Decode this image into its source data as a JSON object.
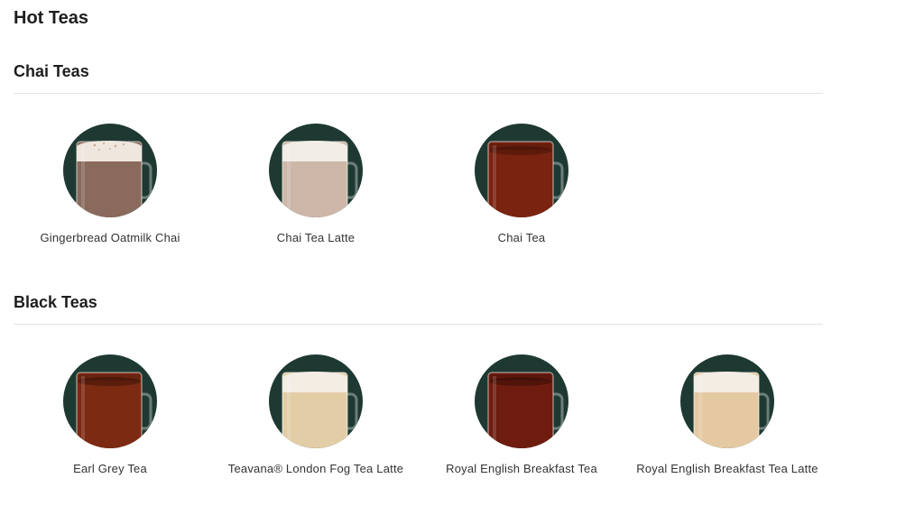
{
  "page": {
    "title": "Hot Teas"
  },
  "sections": [
    {
      "heading": "Chai Teas",
      "products": [
        {
          "name": "Gingerbread Oatmilk Chai",
          "drink": "foam-spiced",
          "body_color": "#8a6a5c",
          "top_color": "#efe6dd"
        },
        {
          "name": "Chai Tea Latte",
          "drink": "latte",
          "body_color": "#cdb7a8",
          "top_color": "#f2ede7"
        },
        {
          "name": "Chai Tea",
          "drink": "tea",
          "body_color": "#7a2310",
          "top_color": "#5e1a0b"
        }
      ]
    },
    {
      "heading": "Black Teas",
      "products": [
        {
          "name": "Earl Grey Tea",
          "drink": "tea",
          "body_color": "#7d2a12",
          "top_color": "#5a1d0c"
        },
        {
          "name": "Teavana® London Fog Tea Latte",
          "drink": "latte",
          "body_color": "#e2cda6",
          "top_color": "#f3ede4"
        },
        {
          "name": "Royal English Breakfast Tea",
          "drink": "tea",
          "body_color": "#6e1c10",
          "top_color": "#521409"
        },
        {
          "name": "Royal English Breakfast Tea Latte",
          "drink": "latte",
          "body_color": "#e5c9a3",
          "top_color": "#f3ede4"
        }
      ]
    }
  ],
  "colors": {
    "thumb_background": "#1e3932",
    "text": "#333333",
    "heading": "#1e1e1e",
    "rule": "#e5e5e5"
  }
}
